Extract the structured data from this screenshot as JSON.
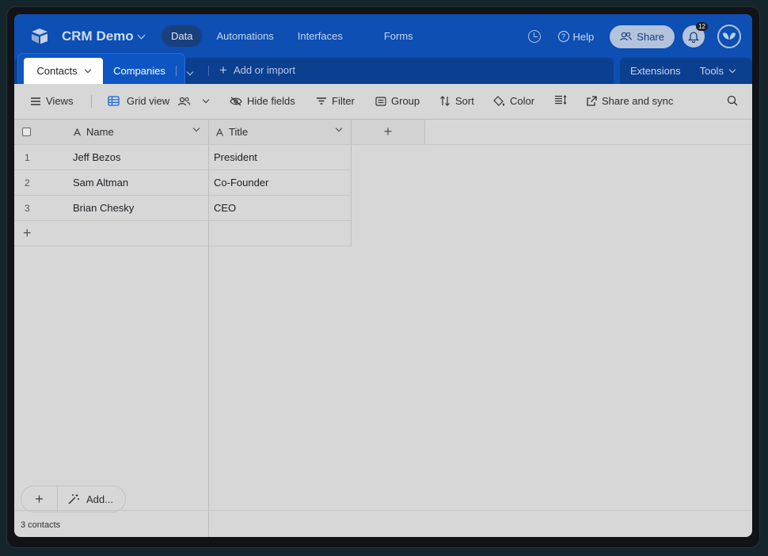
{
  "header": {
    "base_name": "CRM Demo",
    "nav": [
      "Data",
      "Automations",
      "Interfaces",
      "Forms"
    ],
    "active_nav": "Data",
    "help_label": "Help",
    "share_label": "Share",
    "notification_count": "12",
    "brand_color": "#0d4fb3"
  },
  "tables": {
    "tabs": [
      "Contacts",
      "Companies"
    ],
    "active": "Contacts",
    "add_import_label": "Add or import",
    "extensions_label": "Extensions",
    "tools_label": "Tools"
  },
  "toolbar": {
    "views_label": "Views",
    "view_name": "Grid view",
    "hide_fields_label": "Hide fields",
    "filter_label": "Filter",
    "group_label": "Group",
    "sort_label": "Sort",
    "color_label": "Color",
    "share_sync_label": "Share and sync"
  },
  "grid": {
    "columns": [
      "Name",
      "Title"
    ],
    "rows": [
      {
        "num": "1",
        "name": "Jeff Bezos",
        "title": "President"
      },
      {
        "num": "2",
        "name": "Sam Altman",
        "title": "Co-Founder"
      },
      {
        "num": "3",
        "name": "Brian Chesky",
        "title": "CEO"
      }
    ],
    "record_count": "3 contacts",
    "add_label": "Add..."
  }
}
